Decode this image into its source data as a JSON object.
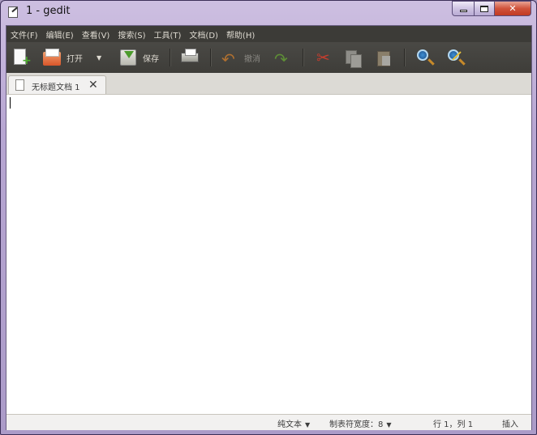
{
  "window": {
    "title": "1 - gedit"
  },
  "menu": {
    "items": [
      "文件(F)",
      "编辑(E)",
      "查看(V)",
      "搜索(S)",
      "工具(T)",
      "文档(D)",
      "帮助(H)"
    ]
  },
  "toolbar": {
    "open_label": "打开",
    "save_label": "保存",
    "undo_label": "撤消"
  },
  "tabs": [
    {
      "label": "无标题文档 1"
    }
  ],
  "editor": {
    "content": ""
  },
  "statusbar": {
    "language": "纯文本",
    "tab_width": "制表符宽度：8",
    "position": "行 1，列 1",
    "mode": "插入"
  }
}
